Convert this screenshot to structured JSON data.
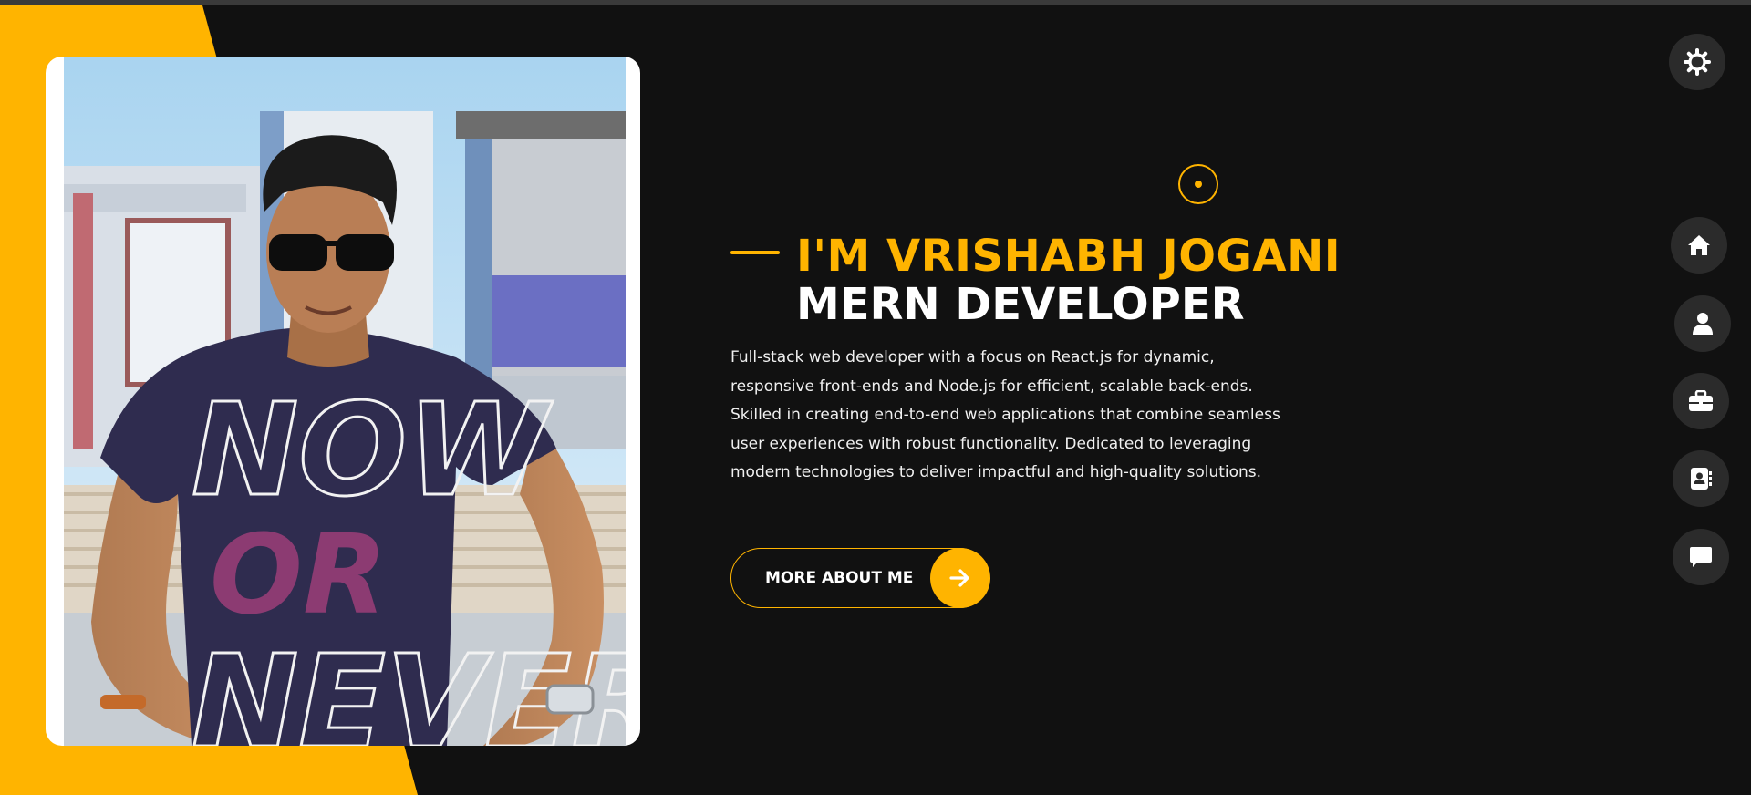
{
  "theme": {
    "accent": "#ffb400",
    "background": "#111111",
    "button_bg": "#2b2b2b",
    "text": "#ffffff"
  },
  "hero": {
    "name_line": "I'M VRISHABH JOGANI",
    "role_line": "MERN DEVELOPER",
    "bio": "Full-stack web developer with a focus on React.js for dynamic, responsive front-ends and Node.js for efficient, scalable back-ends. Skilled in creating end-to-end web applications that combine seamless user experiences with robust functionality. Dedicated to leveraging modern technologies to deliver impactful and high-quality solutions.",
    "cta_label": "MORE ABOUT ME",
    "cta_icon": "arrow-right-icon"
  },
  "photo": {
    "shirt_text_1": "NOW",
    "shirt_text_2": "OR",
    "shirt_text_3": "NEVER"
  },
  "controls": {
    "theme_toggle_icon": "gear-icon"
  },
  "nav": {
    "items": [
      {
        "icon": "home-icon"
      },
      {
        "icon": "user-icon"
      },
      {
        "icon": "briefcase-icon"
      },
      {
        "icon": "contact-book-icon"
      },
      {
        "icon": "chat-icon"
      }
    ]
  }
}
